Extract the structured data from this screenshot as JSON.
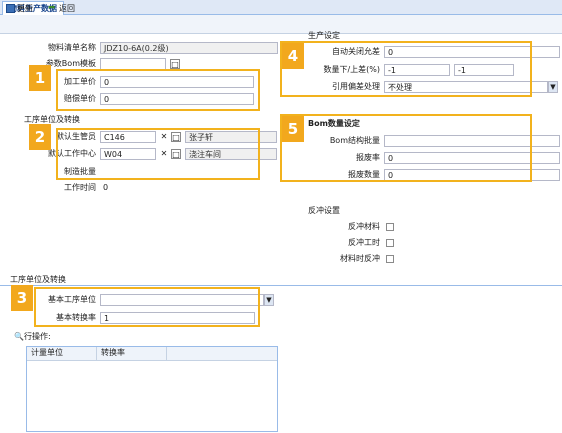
{
  "tab": {
    "title": "物料生产数据"
  },
  "toolbar": {
    "update_label": "更新",
    "back_label": "返回"
  },
  "left": {
    "bom_name_label": "物料清单名称",
    "bom_name_value": "JDZ10-6A(0.2级)",
    "bom_version_label": "参数Bom模板",
    "process_price_label": "加工单价",
    "process_price_value": "0",
    "comp_price_label": "赔偿单价",
    "comp_price_value": "0",
    "section_title": "工序单位及转换",
    "planner_label": "默认生管员",
    "planner_code": "C146",
    "planner_name": "张子轩",
    "workcenter_label": "默认工作中心",
    "workcenter_code": "W04",
    "workcenter_name": "浇注车间",
    "batch_label": "制造批量",
    "worktime_label": "工作时间",
    "worktime_value": "0"
  },
  "right": {
    "section_title": "生产设定",
    "auto_close_label": "自动关闭允差",
    "auto_close_value": "0",
    "qty_limit_label": "数量下/上差(%)",
    "qty_limit_lower": "-1",
    "qty_limit_upper": "-1",
    "ref_handle_label": "引用偏差处理",
    "ref_handle_value": "不处理",
    "bom_section_title": "Bom数量设定",
    "bom_batch_label": "Bom结构批量",
    "scrap_rate_label": "报废率",
    "scrap_rate_value": "0",
    "scrap_qty_label": "报废数量",
    "scrap_qty_value": "0",
    "backflush_title": "反冲设置",
    "bf_material_label": "反冲材料",
    "bf_hours_label": "反冲工时",
    "bf_material_time_label": "材料时反冲"
  },
  "bottom": {
    "section_title": "工序单位及转换",
    "base_unit_label": "基本工序单位",
    "base_unit_value": "",
    "base_rate_label": "基本转换率",
    "base_rate_value": "1",
    "row_ops_label": "行操作:",
    "grid_columns": [
      "计量单位",
      "转换率"
    ]
  },
  "badges": [
    "1",
    "2",
    "3",
    "4",
    "5"
  ],
  "colors": {
    "highlight": "#f2b21d",
    "badge": "#f2a81d"
  }
}
